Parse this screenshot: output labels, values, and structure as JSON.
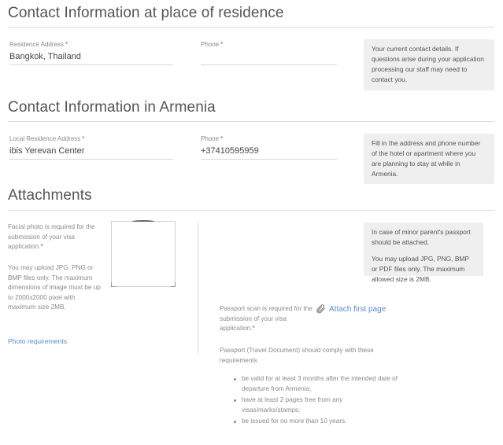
{
  "residence": {
    "title": "Contact Information at place of residence",
    "address_label": "Residence Address",
    "address_value": "Bangkok, Thailand",
    "phone_label": "Phone",
    "phone_value": "",
    "required_mark": "*",
    "info": "Your current contact details. If questions arise during your application processing our staff may need to contact you."
  },
  "armenia": {
    "title": "Contact Information in Armenia",
    "address_label": "Local Residence Address",
    "address_value": "ibis Yerevan Center",
    "phone_label": "Phone",
    "phone_value": "+37410595959",
    "required_mark": "*",
    "info": "Fill in the address and phone number of the hotel or apartment where you are planning to stay at while in Armenia."
  },
  "attachments": {
    "title": "Attachments",
    "photo_required_text": "Facial photo is required for the submission of your visa application.",
    "photo_format_text": "You may upload JPG, PNG or BMP files only. The maximum dimensions of image must be up to 2000x2000 pixel with maximum size 2MB.",
    "photo_requirements_link": "Photo requirements",
    "passport_info_minor": "In case of minor parent's passport should be attached.",
    "passport_info_format": "You may upload JPG, PNG, BMP or PDF files only. The maximum allowed size is 2MB.",
    "passport_required_text": "Passport scan is required for the submission of your visa application.",
    "attach_first_page": "Attach first page",
    "passport_comply_text": "Passport (Travel Document) should comply with these requirements",
    "requirements": [
      "be valid for at least 3 months after the intended date of departure from Armenia;",
      "have at least 2 pages free from any visas/marks/stamps;",
      "be issued for no more than 10 years."
    ],
    "required_mark": "*"
  },
  "colors": {
    "link": "#5b8bc4",
    "required": "#e23c3c",
    "info_box_bg": "#efefef"
  }
}
